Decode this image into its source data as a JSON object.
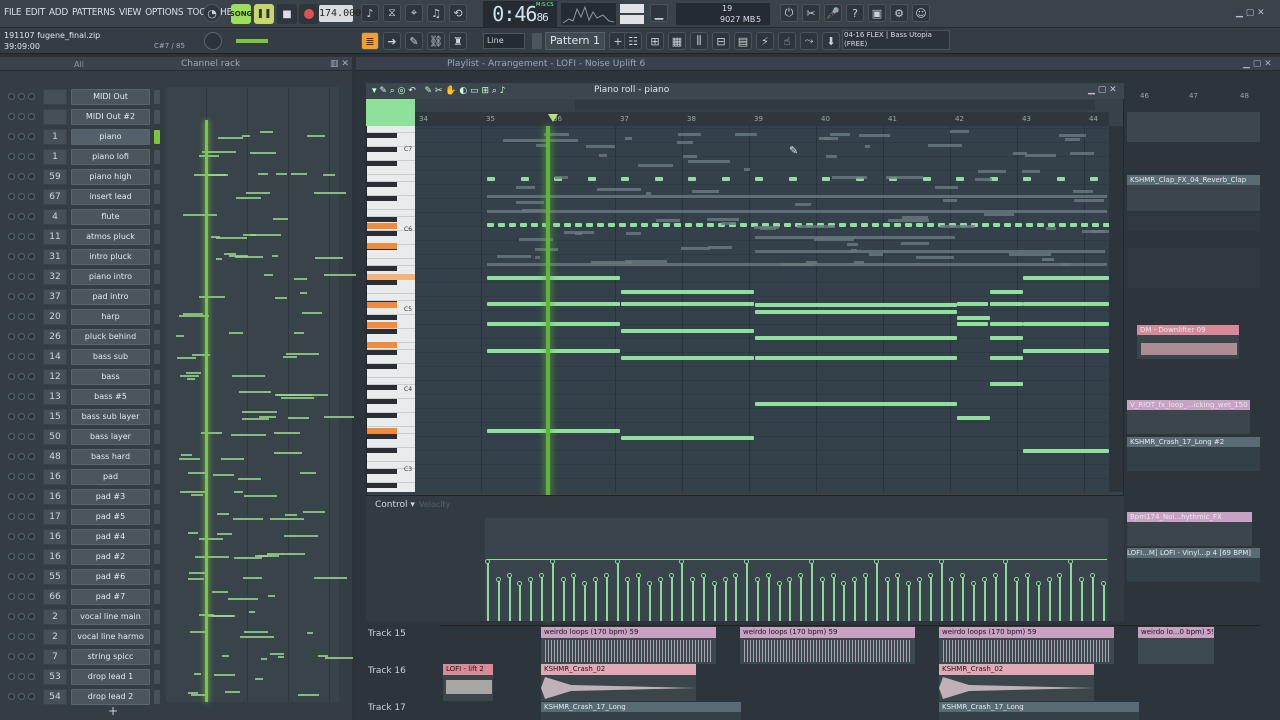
{
  "menu": [
    "FILE",
    "EDIT",
    "ADD",
    "PATTERNS",
    "VIEW",
    "OPTIONS",
    "TOOLS",
    "HELP"
  ],
  "transport": {
    "song_label": "SONG",
    "tempo": "174.000",
    "time": "0:46",
    "time_sub": "86",
    "msc_label": "M:S:CS"
  },
  "cpu": {
    "voices": "19",
    "ram": "9027 MB",
    "cores": "5"
  },
  "project": {
    "name": "191107 fugene_final.zip",
    "time": "39:09:00",
    "note": "C#7 / 85"
  },
  "toolbar": {
    "snap": "Line",
    "pattern": "Pattern 1"
  },
  "plugin_info": {
    "line1": "04-16  FLEX | Bass Utopia",
    "line2": "(FREE)"
  },
  "channel_rack": {
    "title": "Channel rack",
    "filter": "All",
    "add": "+",
    "channels": [
      {
        "num": "",
        "name": "MIDI Out"
      },
      {
        "num": "",
        "name": "MIDI Out #2"
      },
      {
        "num": "1",
        "name": "piano"
      },
      {
        "num": "1",
        "name": "piano lofi"
      },
      {
        "num": "59",
        "name": "piano high"
      },
      {
        "num": "67",
        "name": "insert lead"
      },
      {
        "num": "4",
        "name": "flute"
      },
      {
        "num": "11",
        "name": "atmos pluck"
      },
      {
        "num": "31",
        "name": "intro pluck"
      },
      {
        "num": "32",
        "name": "piano intro"
      },
      {
        "num": "37",
        "name": "pad intro"
      },
      {
        "num": "20",
        "name": "harp"
      },
      {
        "num": "26",
        "name": "pluck behind"
      },
      {
        "num": "14",
        "name": "bass sub"
      },
      {
        "num": "12",
        "name": "bass"
      },
      {
        "num": "13",
        "name": "bass #5"
      },
      {
        "num": "15",
        "name": "bass sub layer"
      },
      {
        "num": "50",
        "name": "bass layer"
      },
      {
        "num": "48",
        "name": "bass hard"
      },
      {
        "num": "16",
        "name": "pad"
      },
      {
        "num": "16",
        "name": "pad #3"
      },
      {
        "num": "17",
        "name": "pad #5"
      },
      {
        "num": "16",
        "name": "pad #4"
      },
      {
        "num": "16",
        "name": "pad #2"
      },
      {
        "num": "55",
        "name": "pad #6"
      },
      {
        "num": "66",
        "name": "pad #7"
      },
      {
        "num": "2",
        "name": "vocal line main"
      },
      {
        "num": "2",
        "name": "vocal line harmo"
      },
      {
        "num": "7",
        "name": "string spicc"
      },
      {
        "num": "53",
        "name": "drop lead 1"
      },
      {
        "num": "54",
        "name": "drop lead 2"
      }
    ]
  },
  "playlist": {
    "title": "Playlist - Arrangement",
    "arrangement": "LOFI - Noise Uplift 6",
    "tracks": [
      "Track 15",
      "Track 16",
      "Track 17"
    ],
    "clips": {
      "weirdo": "weirdo loops (170 bpm) 59",
      "weirdo_short": "weirdo lo...0 bpm) 59",
      "lofi_lift": "LOFI - lift 2",
      "crash": "KSHMR_Crash_02",
      "crash_long": "KSHMR_Crash_17_Long"
    },
    "right_clips": {
      "clap": "KSHMR_Clap_FX_04_Reverb_Clap",
      "downlifter": "DM - Downlifter 09",
      "riot": "V_RIOT_fx_loop_...icking_wet_150",
      "crash_long2": "KSHMR_Crash_17_Long #2",
      "noi": "Bpm174_Noi...hythmic_FX",
      "lofi_vinyl": "LOFI...M]",
      "lofi_vinyl2": "LOFI - Vinyl...p 4 [69 BPM]"
    },
    "ruler_right": [
      "46",
      "47",
      "48"
    ]
  },
  "piano_roll": {
    "title": "Piano roll - piano",
    "ruler": [
      "34",
      "35",
      "36",
      "37",
      "38",
      "39",
      "40",
      "41",
      "42",
      "43",
      "44"
    ],
    "octaves": [
      "C7",
      "C6",
      "C5",
      "C4",
      "C3"
    ],
    "control_label": "Control",
    "control_param": "Velocity"
  },
  "colors": {
    "accent": "#8fe09a",
    "playhead": "#7bc74a",
    "clip_header": "#c9a1c2"
  }
}
